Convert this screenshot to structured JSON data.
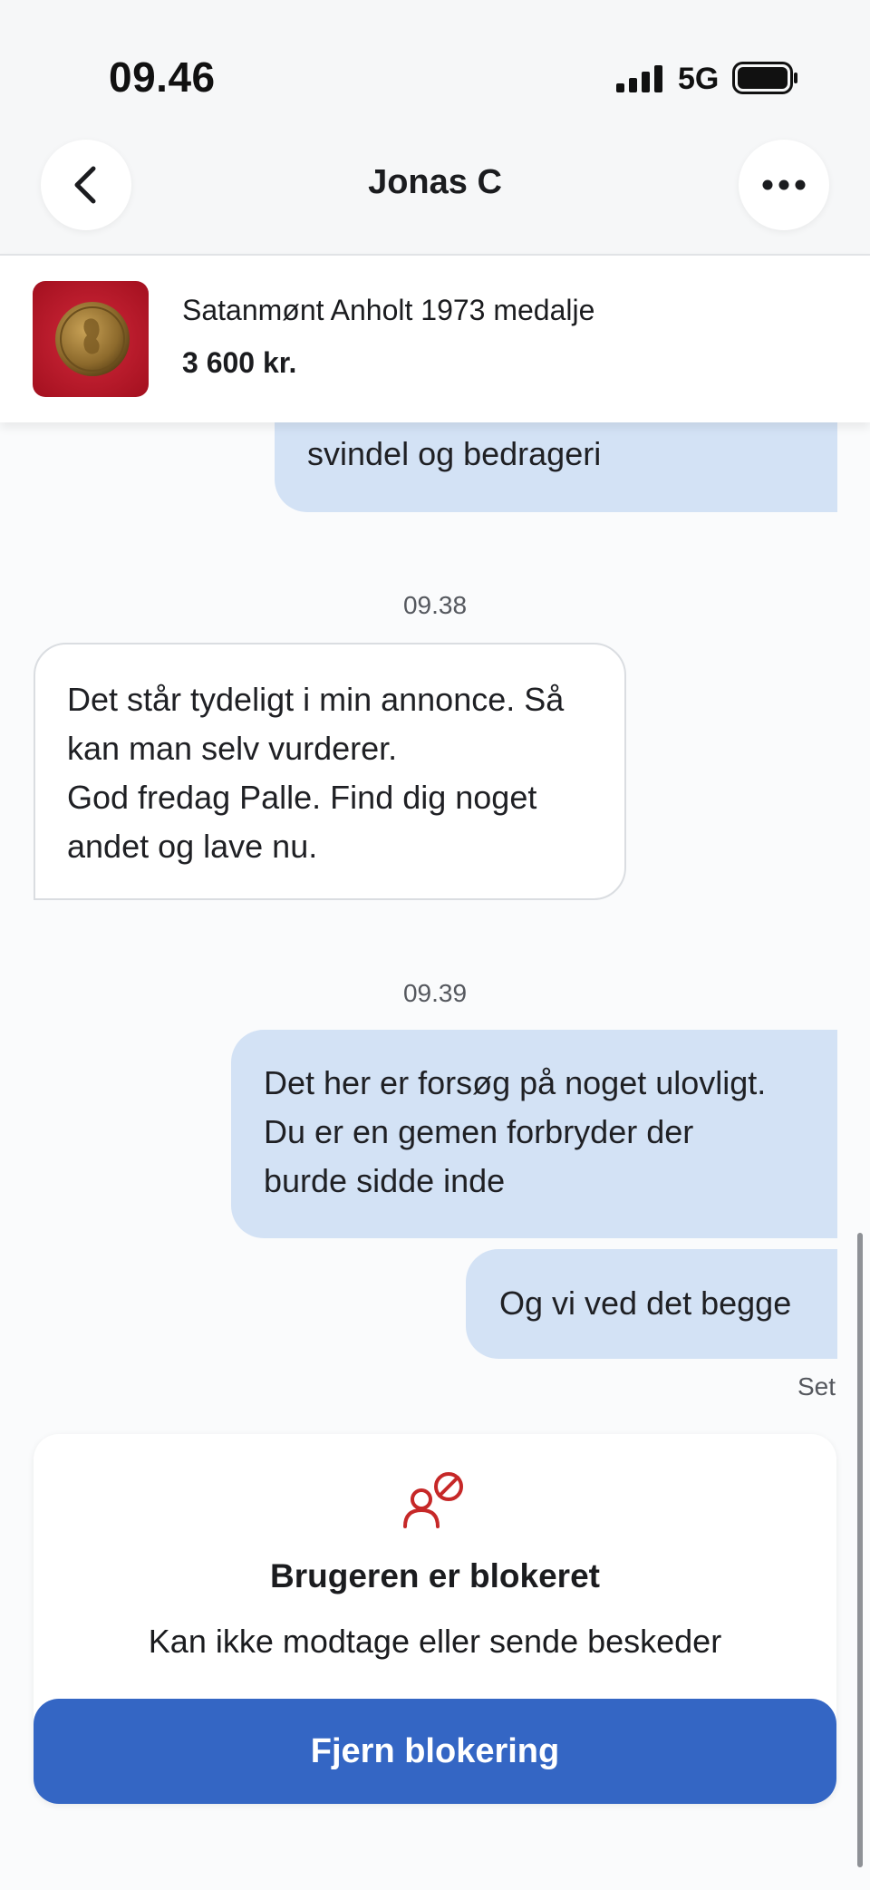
{
  "status_bar": {
    "time": "09.46",
    "network": "5G",
    "icons": [
      "cellular-signal-icon",
      "battery-icon"
    ]
  },
  "header": {
    "title": "Jonas C",
    "icons": [
      "chevron-left-icon",
      "more-horizontal-icon"
    ]
  },
  "listing": {
    "title": "Satanmønt Anholt 1973 medalje",
    "price": "3 600 kr."
  },
  "chat": {
    "partial_message": {
      "lines": [
        "svindel og bedrageri"
      ]
    },
    "groups": [
      {
        "time": "09.38",
        "messages": [
          {
            "direction": "incoming",
            "lines": [
              "Det står tydeligt i min annonce. Så",
              "kan man selv vurderer.",
              "God fredag Palle. Find dig noget",
              "andet og lave nu."
            ]
          }
        ]
      },
      {
        "time": "09.39",
        "messages": [
          {
            "direction": "outgoing",
            "lines": [
              "Det her er forsøg på noget ulovligt.",
              "Du er en gemen forbryder der",
              "burde sidde inde"
            ]
          },
          {
            "direction": "outgoing",
            "lines": [
              "Og vi ved det begge"
            ]
          }
        ]
      }
    ],
    "seen_label": "Set"
  },
  "blocked_notice": {
    "icon": "user-blocked-icon",
    "title": "Brugeren er blokeret",
    "description": "Kan ikke modtage eller sende beskeder",
    "button_label": "Fjern blokering"
  },
  "colors": {
    "outgoing_bubble": "#d3e2f5",
    "primary_button": "#3466c4",
    "blocked_icon": "#c62828"
  }
}
